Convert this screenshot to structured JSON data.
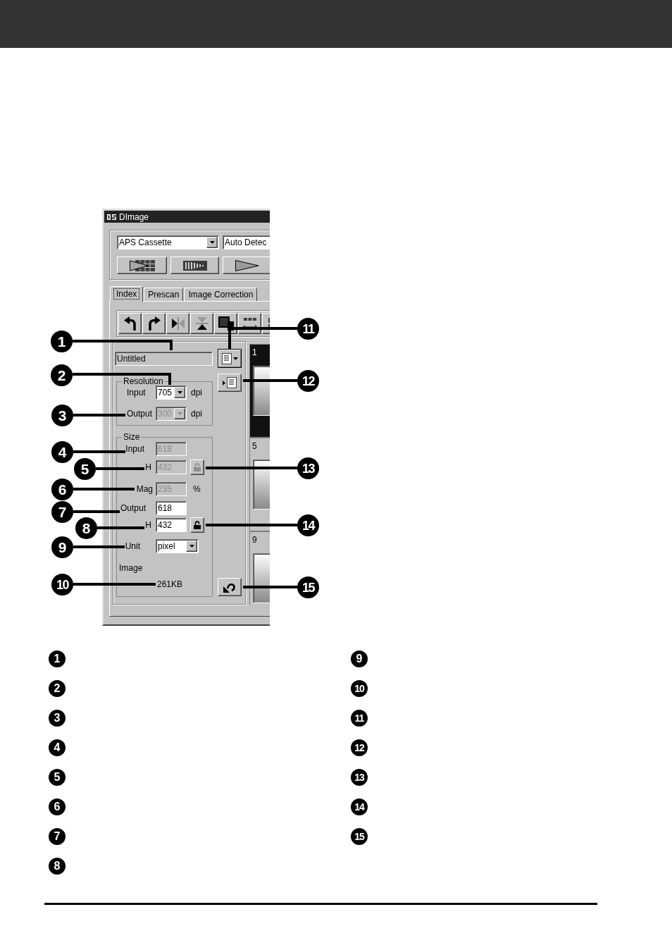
{
  "window": {
    "title": "DImage",
    "film_type": {
      "value": "APS Cassette"
    },
    "detection": {
      "value": "Auto Detec"
    },
    "tabs": [
      {
        "label": "Index",
        "selected": true
      },
      {
        "label": "Prescan",
        "selected": false
      },
      {
        "label": "Image Correction",
        "selected": false
      }
    ],
    "file_name": {
      "value": "Untitled",
      "read_only": true
    },
    "resolution": {
      "title": "Resolution",
      "rows": [
        {
          "label": "Input",
          "value": "705",
          "unit": "dpi",
          "disabled": false
        },
        {
          "label": "Output",
          "value": "300",
          "unit": "dpi",
          "disabled": true
        }
      ]
    },
    "size": {
      "title": "Size",
      "rows": [
        {
          "kind": "field",
          "label": "Input",
          "value": "618",
          "disabled": true
        },
        {
          "kind": "field",
          "label": "H",
          "value": "432",
          "disabled": true,
          "lock_button": {
            "disabled": true
          }
        },
        {
          "kind": "field",
          "label": "Mag",
          "value": "235",
          "unit": "%",
          "disabled": true
        },
        {
          "kind": "field",
          "label": "Output",
          "value": "618",
          "disabled": false
        },
        {
          "kind": "field",
          "label": "H",
          "value": "432",
          "disabled": false,
          "lock_button": {
            "disabled": false
          }
        },
        {
          "kind": "dropdown",
          "label": "Unit",
          "value": "pixel",
          "disabled": false
        }
      ],
      "image_size": {
        "label": "Image",
        "value": "261KB"
      }
    },
    "thumbnails": [
      {
        "number": "1",
        "selected": true
      },
      {
        "number": "5",
        "selected": false
      },
      {
        "number": "9",
        "selected": false
      }
    ]
  },
  "callouts": [
    {
      "number": "1"
    },
    {
      "number": "2"
    },
    {
      "number": "3"
    },
    {
      "number": "4"
    },
    {
      "number": "5"
    },
    {
      "number": "6"
    },
    {
      "number": "7"
    },
    {
      "number": "8"
    },
    {
      "number": "9"
    },
    {
      "number": "10"
    },
    {
      "number": "11"
    },
    {
      "number": "12"
    },
    {
      "number": "13"
    },
    {
      "number": "14"
    },
    {
      "number": "15"
    }
  ],
  "legend": {
    "columns": [
      {
        "items": [
          "1",
          "2",
          "3",
          "4",
          "5",
          "6",
          "7",
          "8"
        ]
      },
      {
        "items": [
          "9",
          "10",
          "11",
          "12",
          "13",
          "14",
          "15"
        ]
      }
    ]
  }
}
